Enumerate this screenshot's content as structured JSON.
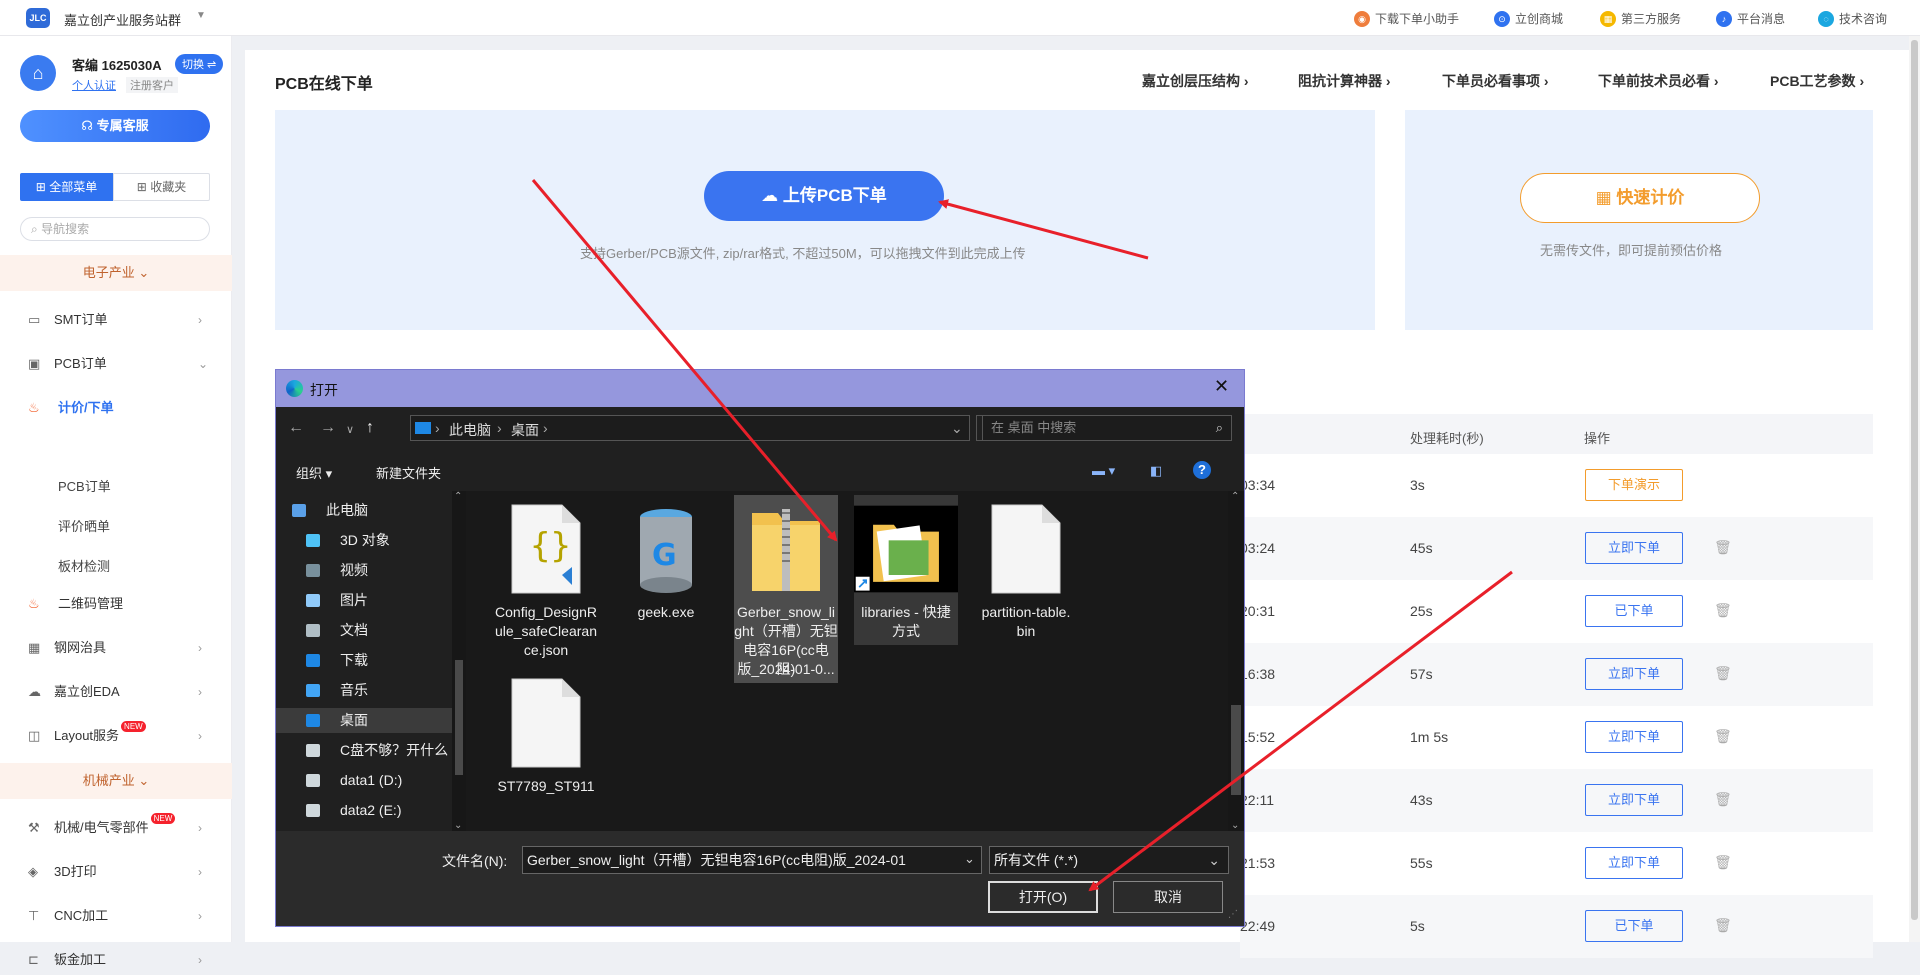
{
  "topbar": {
    "logo_text": "JLC",
    "site_title": "嘉立创产业服务站群",
    "links": [
      {
        "label": "下载下单小助手",
        "icon": "assistant-icon",
        "color": "#ef7d3c"
      },
      {
        "label": "立创商城",
        "icon": "mall-icon",
        "color": "#2f72f0"
      },
      {
        "label": "第三方服务",
        "icon": "grid-service-icon",
        "color": "#f5b800"
      },
      {
        "label": "平台消息",
        "icon": "bell-icon",
        "color": "#2f72f0"
      },
      {
        "label": "技术咨询",
        "icon": "chat-icon",
        "color": "#1ba7e0"
      }
    ]
  },
  "sidebar": {
    "customer_id": "客编 1625030A",
    "switch_label": "切换 ⇌",
    "verify_label": "个人认证",
    "register_tag": "注册客户",
    "service_button": "专属客服",
    "menu_all": "全部菜单",
    "menu_fav": "收藏夹",
    "search_placeholder": "导航搜索",
    "section_electronics": "电子产业",
    "section_mechanical": "机械产业",
    "items": [
      {
        "label": "SMT订单",
        "icon": "smt-icon"
      },
      {
        "label": "PCB订单",
        "icon": "pcb-icon"
      },
      {
        "label": "计价/下单",
        "icon": "fire-icon",
        "active": true
      },
      {
        "label": "PCB订单"
      },
      {
        "label": "评价晒单"
      },
      {
        "label": "板材检测"
      },
      {
        "label": "二维码管理",
        "icon": "fire-icon"
      },
      {
        "label": "钢网治具",
        "icon": "grid-icon"
      },
      {
        "label": "嘉立创EDA",
        "icon": "eda-icon"
      },
      {
        "label": "Layout服务",
        "icon": "layout-icon",
        "badge": "NEW"
      },
      {
        "label": "机械/电气零部件",
        "icon": "wrench-icon",
        "badge": "NEW"
      },
      {
        "label": "3D打印",
        "icon": "3d-print-icon"
      },
      {
        "label": "CNC加工",
        "icon": "cnc-icon"
      },
      {
        "label": "钣金加工",
        "icon": "sheet-metal-icon"
      }
    ]
  },
  "main": {
    "title": "PCB在线下单",
    "links": [
      "嘉立创层压结构 ›",
      "阻抗计算神器 ›",
      "下单员必看事项 ›",
      "下单前技术员必看 ›",
      "PCB工艺参数 ›"
    ],
    "upload_button": "上传PCB下单",
    "upload_hint": "支持Gerber/PCB源文件, zip/rar格式, 不超过50M，可以拖拽文件到此完成上传",
    "quote_button": "快速计价",
    "quote_hint": "无需传文件，即可提前预估价格",
    "table_headers": {
      "duration": "处理耗时(秒)",
      "action": "操作"
    },
    "rows": [
      {
        "time": "03:34",
        "duration": "3s",
        "action": "下单演示",
        "style": "orange"
      },
      {
        "time": "03:24",
        "duration": "45s",
        "action": "立即下单"
      },
      {
        "time": "20:31",
        "duration": "25s",
        "action": "已下单"
      },
      {
        "time": "16:38",
        "duration": "57s",
        "action": "立即下单"
      },
      {
        "time": "15:52",
        "duration": "1m 5s",
        "action": "立即下单"
      },
      {
        "time": "22:11",
        "duration": "43s",
        "action": "立即下单"
      },
      {
        "time": "21:53",
        "duration": "55s",
        "action": "立即下单"
      },
      {
        "time": "22:49",
        "duration": "5s",
        "action": "已下单"
      }
    ]
  },
  "dialog": {
    "title": "打开",
    "breadcrumb": [
      "此电脑",
      "桌面"
    ],
    "search_placeholder": "在 桌面 中搜索",
    "toolbar": {
      "organize": "组织 ▾",
      "new_folder": "新建文件夹"
    },
    "tree": [
      {
        "label": "此电脑",
        "icon": "computer-icon",
        "color": "#5aa0e8"
      },
      {
        "label": "3D 对象",
        "icon": "3d-objects-icon",
        "color": "#4fc3f7"
      },
      {
        "label": "视频",
        "icon": "video-icon",
        "color": "#78909c"
      },
      {
        "label": "图片",
        "icon": "pictures-icon",
        "color": "#90caf9"
      },
      {
        "label": "文档",
        "icon": "documents-icon",
        "color": "#b0bec5"
      },
      {
        "label": "下载",
        "icon": "download-icon",
        "color": "#1e88e5"
      },
      {
        "label": "音乐",
        "icon": "music-icon",
        "color": "#42a5f5"
      },
      {
        "label": "桌面",
        "icon": "desktop-icon",
        "color": "#1e88e5",
        "selected": true
      },
      {
        "label": "C盘不够？开什么",
        "icon": "drive-icon",
        "color": "#cfd8dc"
      },
      {
        "label": "data1 (D:)",
        "icon": "drive-icon",
        "color": "#cfd8dc"
      },
      {
        "label": "data2 (E:)",
        "icon": "drive-icon",
        "color": "#cfd8dc"
      }
    ],
    "files": [
      {
        "name": "Config_DesignRule_safeClearance.json",
        "lines": [
          "Config_DesignR",
          "ule_safeClearan",
          "ce.json"
        ],
        "icon": "json-file-icon"
      },
      {
        "name": "geek.exe",
        "lines": [
          "geek.exe"
        ],
        "icon": "geek-exe-icon"
      },
      {
        "name": "Gerber_snow_light（开槽）无钽电容16P(cc电阻)版_2024-01-0...",
        "lines": [
          "Gerber_snow_li",
          "ght（开槽）无钽",
          "电容16P(cc电阻)",
          "版_2024-01-0..."
        ],
        "icon": "zip-folder-icon",
        "selected": true
      },
      {
        "name": "libraries - 快捷方式",
        "lines": [
          "libraries - 快捷",
          "方式"
        ],
        "icon": "shortcut-folder-icon"
      },
      {
        "name": "partition-table.bin",
        "lines": [
          "partition-table.",
          "bin"
        ],
        "icon": "blank-file-icon"
      },
      {
        "name": "ST7789_ST911",
        "lines": [
          "ST7789_ST911"
        ],
        "icon": "blank-file-icon"
      }
    ],
    "filename_label": "文件名(N):",
    "filename_value": "Gerber_snow_light（开槽）无钽电容16P(cc电阻)版_2024-01",
    "filetype_value": "所有文件 (*.*)",
    "open_button": "打开(O)",
    "cancel_button": "取消"
  },
  "annotation_color": "#e8202a"
}
